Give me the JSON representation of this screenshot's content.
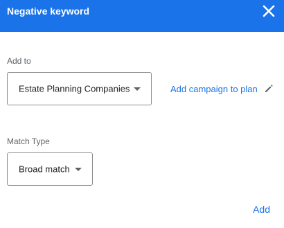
{
  "header": {
    "title": "Negative keyword",
    "close_icon": "close-icon",
    "background_color": "#1a73e8"
  },
  "add_to": {
    "label": "Add to",
    "selected": "Estate Planning Companies",
    "link_label": "Add campaign to plan",
    "edit_icon": "pencil-icon"
  },
  "match_type": {
    "label": "Match Type",
    "selected": "Broad match"
  },
  "footer": {
    "add_label": "Add"
  },
  "colors": {
    "accent": "#1a73e8",
    "label_text": "#5f6368",
    "value_text": "#202124"
  }
}
